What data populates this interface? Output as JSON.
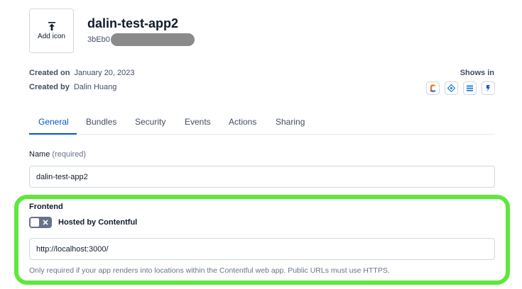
{
  "app": {
    "add_icon_label": "Add icon",
    "name": "dalin-test-app2",
    "id_prefix": "3bEb0"
  },
  "meta": {
    "created_on_label": "Created on",
    "created_on_value": "January 20, 2023",
    "created_by_label": "Created by",
    "created_by_value": "Dalin Huang",
    "shows_in_label": "Shows in",
    "locations": [
      "content-types",
      "entry-editor",
      "sidebar",
      "field"
    ]
  },
  "tabs": [
    {
      "label": "General",
      "active": true
    },
    {
      "label": "Bundles",
      "active": false
    },
    {
      "label": "Security",
      "active": false
    },
    {
      "label": "Events",
      "active": false
    },
    {
      "label": "Actions",
      "active": false
    },
    {
      "label": "Sharing",
      "active": false
    }
  ],
  "name_field": {
    "label": "Name",
    "required": "(required)",
    "value": "dalin-test-app2"
  },
  "frontend": {
    "title": "Frontend",
    "toggle_label": "Hosted by Contentful",
    "toggle_on": false,
    "url_value": "http://localhost:3000/",
    "help_text": "Only required if your app renders into locations within the Contentful web app. Public URLs must use HTTPS."
  },
  "colors": {
    "accent": "#0059c8",
    "highlight": "#5ee83b"
  }
}
